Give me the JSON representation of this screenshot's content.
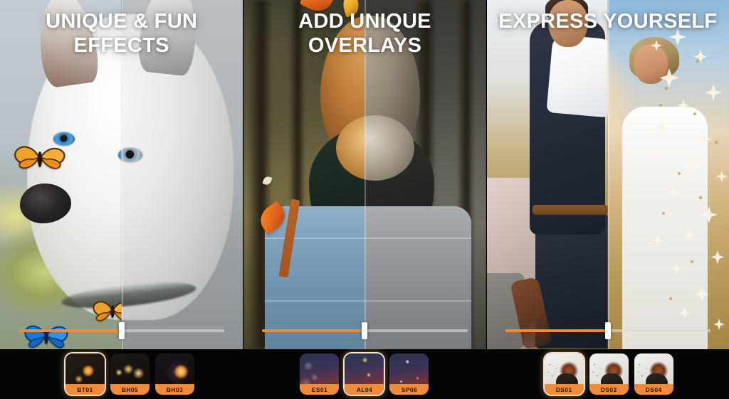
{
  "app": {
    "screenshot_title": "Photo Effects App Store Gallery",
    "accent_color": "#ef8b3c",
    "toolbar_background": "#050505",
    "title_color": "#ffffff"
  },
  "panels": [
    {
      "id": "panel-effects",
      "title": "UNIQUE & FUN EFFECTS",
      "subject": "husky dog with butterfly overlays",
      "compare_slider": {
        "name": "before-after-slider",
        "value_percent": 50,
        "fill_color": "#f08a3c",
        "track_color": "rgba(215,218,220,0.65)",
        "handle_color": "#ffffff"
      },
      "thumbnails": [
        {
          "label": "BT01",
          "art": "art-bt01",
          "selected": true
        },
        {
          "label": "BH05",
          "art": "art-bh05",
          "selected": false
        },
        {
          "label": "BH03",
          "art": "art-bh03",
          "selected": false
        }
      ]
    },
    {
      "id": "panel-overlays",
      "title": "ADD UNIQUE OVERLAYS",
      "subject": "woman in denim jacket in autumn forest with falling leaf overlays",
      "compare_slider": {
        "name": "before-after-slider",
        "value_percent": 50,
        "fill_color": "#f08a3c",
        "track_color": "rgba(215,218,220,0.65)",
        "handle_color": "#ffffff"
      },
      "thumbnails": [
        {
          "label": "ES01",
          "art": "art-es01",
          "selected": false
        },
        {
          "label": "AL04",
          "art": "art-al04",
          "selected": true
        },
        {
          "label": "SP06",
          "art": "art-sp06",
          "selected": false
        }
      ]
    },
    {
      "id": "panel-express",
      "title": "EXPRESS YOURSELF",
      "subject": "wedding couple at sunset with star dispersion effect",
      "compare_slider": {
        "name": "before-after-slider",
        "value_percent": 50,
        "fill_color": "#f08a3c",
        "track_color": "rgba(215,218,220,0.65)",
        "handle_color": "#ffffff"
      },
      "thumbnails": [
        {
          "label": "DS01",
          "art": "art-ds",
          "selected": true
        },
        {
          "label": "DS02",
          "art": "art-ds",
          "selected": false
        },
        {
          "label": "DS04",
          "art": "art-ds",
          "selected": false
        }
      ]
    }
  ]
}
